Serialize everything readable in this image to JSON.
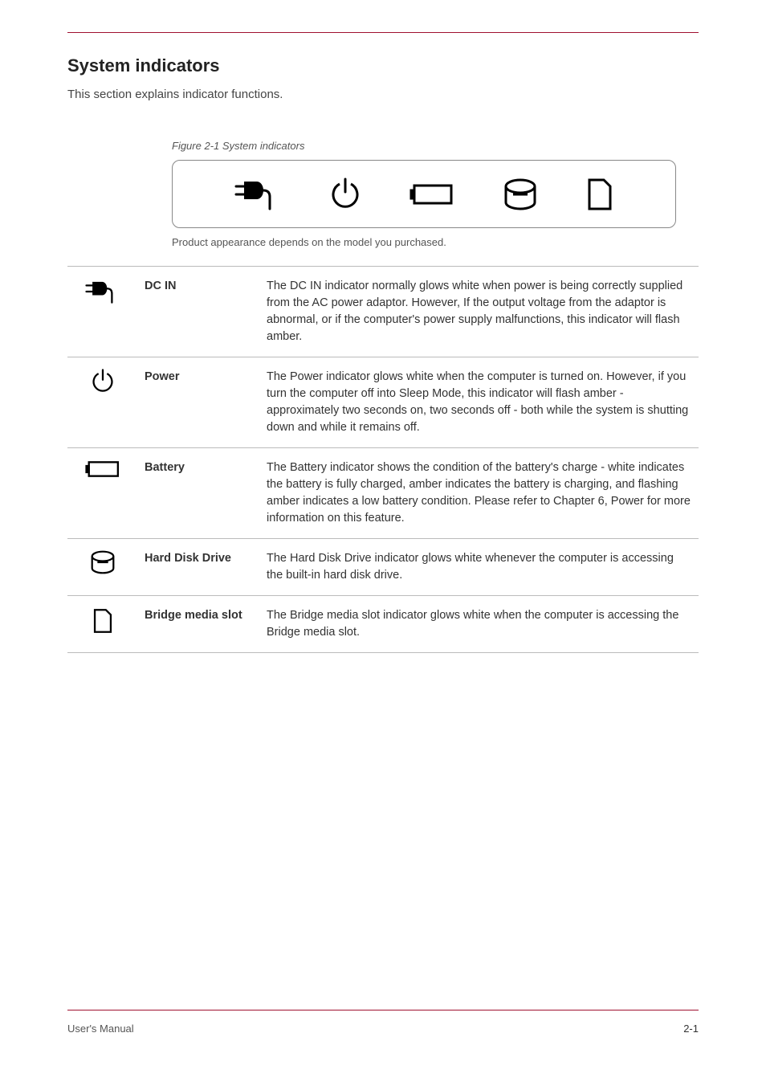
{
  "title": "System indicators",
  "intro": "This section explains indicator functions.",
  "figure_label": "Figure 2-1 System indicators",
  "caption": "Product appearance depends on the model you purchased.",
  "rows": [
    {
      "label": "DC IN",
      "desc": "The DC IN indicator normally glows white when power is being correctly supplied from the AC power adaptor. However, If the output voltage from the adaptor is abnormal, or if the computer's power supply malfunctions, this indicator will flash amber."
    },
    {
      "label": "Power",
      "desc": "The Power indicator glows white when the computer is turned on. However, if you turn the computer off into Sleep Mode, this indicator will flash amber - approximately two seconds on, two seconds off - both while the system is shutting down and while it remains off."
    },
    {
      "label": "Battery",
      "desc": "The Battery indicator shows the condition of the battery's charge - white indicates the battery is fully charged, amber indicates the battery is charging, and flashing amber indicates a low battery condition. Please refer to Chapter 6, Power for more information on this feature."
    },
    {
      "label": "Hard Disk Drive",
      "desc": "The Hard Disk Drive indicator glows white whenever the computer is accessing the built-in hard disk drive."
    },
    {
      "label": "Bridge media slot",
      "desc": "The Bridge media slot indicator glows white when the computer is accessing the Bridge media slot."
    }
  ],
  "footer": {
    "left": "User's Manual",
    "right": "2-1"
  }
}
